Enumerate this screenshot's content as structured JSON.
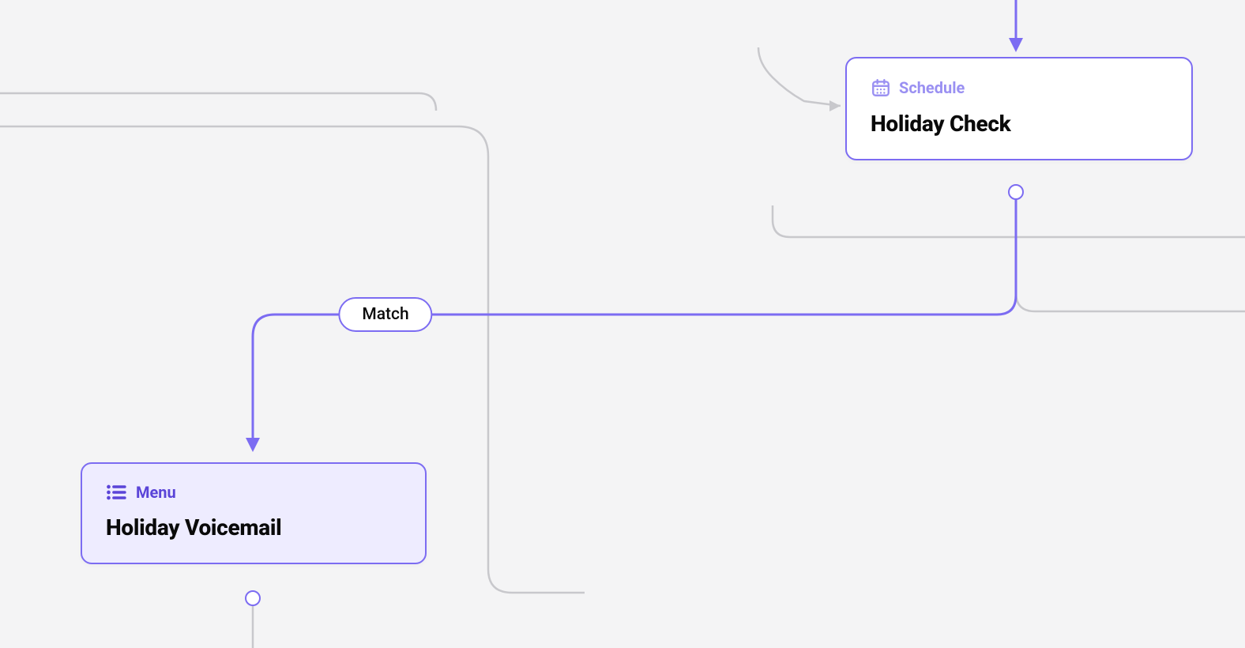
{
  "nodes": {
    "schedule": {
      "type_label": "Schedule",
      "title": "Holiday Check"
    },
    "menu": {
      "type_label": "Menu",
      "title": "Holiday Voicemail"
    }
  },
  "edges": {
    "match": {
      "label": "Match"
    }
  },
  "colors": {
    "accent": "#7c6cf2",
    "accent_dark": "#5a44d8",
    "node_selected_bg": "#eeecff",
    "canvas_bg": "#f4f4f5",
    "gray_line": "#c8c8cc"
  }
}
